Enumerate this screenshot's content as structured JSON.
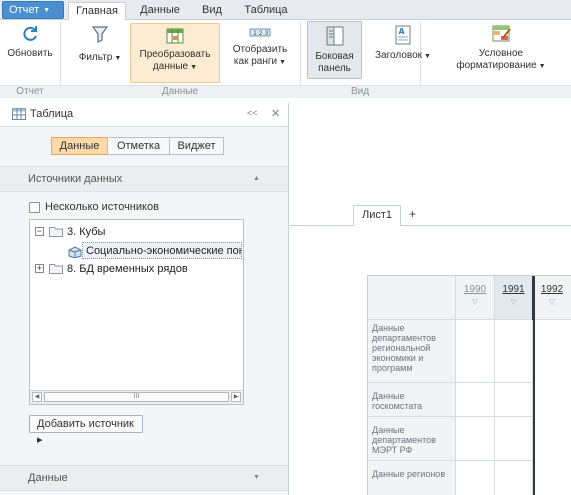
{
  "tabs": {
    "app_menu": "Отчет",
    "home": "Главная",
    "data": "Данные",
    "view": "Вид",
    "table": "Таблица"
  },
  "ribbon": {
    "refresh": "Обновить",
    "filter": "Фильтр",
    "transform_1": "Преобразовать",
    "transform_2": "данные",
    "ranks_1": "Отобразить",
    "ranks_2": "как ранги",
    "sidepanel_1": "Боковая",
    "sidepanel_2": "панель",
    "header": "Заголовок",
    "condfmt_1": "Условное",
    "condfmt_2": "форматирование",
    "groups": {
      "report": "Отчет",
      "data": "Данные",
      "view": "Вид"
    }
  },
  "panel": {
    "title": "Таблица",
    "collapse": "<<",
    "close": "✕",
    "segments": [
      "Данные",
      "Отметка",
      "Виджет"
    ],
    "sources_section": "Источники данных",
    "multiple_sources": "Несколько источников",
    "tree": [
      {
        "label": "3. Кубы"
      },
      {
        "label": "Социально-экономические показ"
      },
      {
        "label": "8. БД временных рядов"
      }
    ],
    "scroll_mid": "III",
    "add_source": "Добавить источник ▸",
    "data_section": "Данные"
  },
  "sheet": {
    "tab": "Лист1",
    "add": "+"
  },
  "table": {
    "years": [
      "1990",
      "1991",
      "1992"
    ],
    "rows": [
      "Данные департаментов региональной экономики и программ",
      "Данные госкомстата",
      "Данные департаментов МЭРТ РФ",
      "Данные регионов"
    ]
  },
  "colors": {
    "accent": "#4a8fd0",
    "highlight": "#fdebd2",
    "segment_on": "#fbd9a8"
  }
}
